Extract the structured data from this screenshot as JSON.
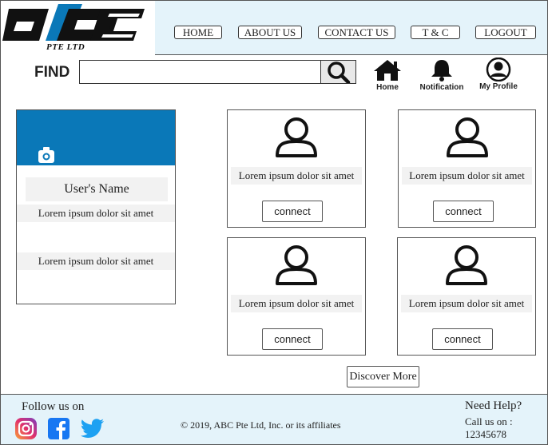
{
  "brand": {
    "logo_text": "PTE LTD"
  },
  "nav": {
    "home": "HOME",
    "about": "ABOUT US",
    "contact": "CONTACT US",
    "terms": "T & C",
    "logout": "LOGOUT"
  },
  "search": {
    "label": "FIND",
    "value": "",
    "placeholder": ""
  },
  "top_icons": {
    "home": "Home",
    "notification": "Notification",
    "profile": "My Profile"
  },
  "profile": {
    "name": "User's Name",
    "line1": "Lorem ipsum dolor sit amet",
    "line2": "Lorem ipsum dolor sit amet"
  },
  "connections": [
    {
      "text": "Lorem ipsum dolor sit amet",
      "button": "connect"
    },
    {
      "text": "Lorem ipsum dolor sit amet",
      "button": "connect"
    },
    {
      "text": "Lorem ipsum dolor sit amet",
      "button": "connect"
    },
    {
      "text": "Lorem ipsum dolor sit amet",
      "button": "connect"
    }
  ],
  "discover": "Discover More",
  "footer": {
    "follow": "Follow us on",
    "copyright": "© 2019, ABC Pte Ltd, Inc. or its affiliates",
    "need_help": "Need Help?",
    "call_us": "Call us on :",
    "phone": "12345678"
  },
  "colors": {
    "header_bg": "#e4f3fa",
    "banner": "#0a78b8",
    "instagram": "#c13584",
    "facebook": "#1877f2",
    "twitter": "#1da1f2"
  },
  "icons": [
    "search-icon",
    "home-icon",
    "bell-icon",
    "user-circle-icon",
    "camera-icon",
    "user-icon",
    "instagram-icon",
    "facebook-icon",
    "twitter-icon"
  ]
}
